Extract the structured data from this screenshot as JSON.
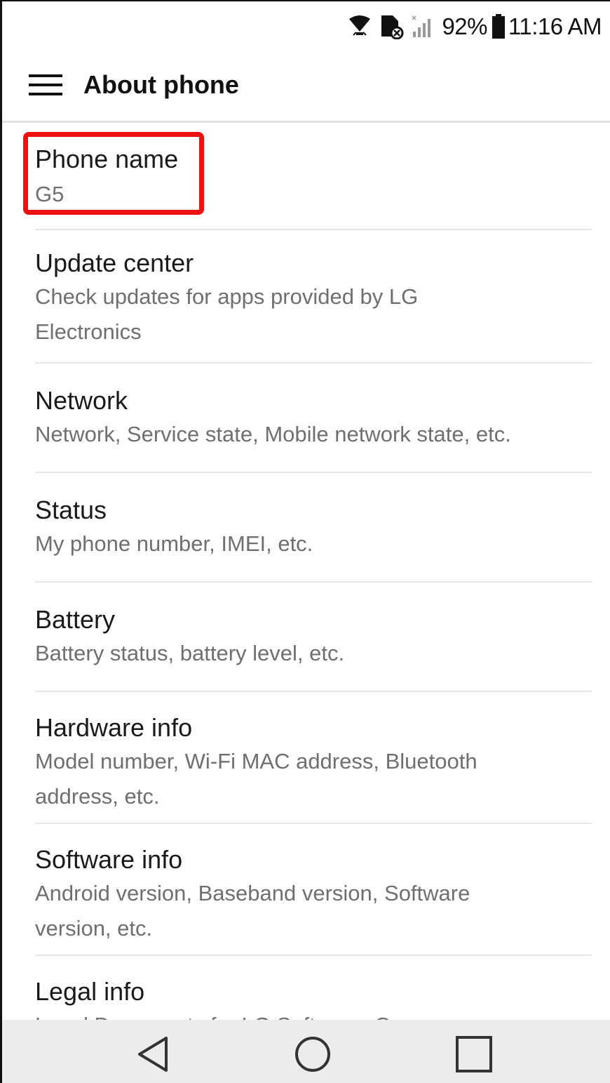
{
  "status_bar": {
    "battery_text": "92%",
    "time": "11:16 AM",
    "icons": [
      "wifi-icon",
      "sim-no-service-icon",
      "signal-icon",
      "battery-icon"
    ]
  },
  "toolbar": {
    "title": "About phone",
    "menu_icon": "hamburger-menu-icon"
  },
  "settings": {
    "items": [
      {
        "title": "Phone name",
        "summary": "G5"
      },
      {
        "title": "Update center",
        "summary": "Check updates for apps provided by LG Electronics"
      },
      {
        "title": "Network",
        "summary": "Network, Service state, Mobile network state, etc."
      },
      {
        "title": "Status",
        "summary": "My phone number, IMEI, etc."
      },
      {
        "title": "Battery",
        "summary": "Battery status, battery level, etc."
      },
      {
        "title": "Hardware info",
        "summary": "Model number, Wi-Fi MAC address, Bluetooth address, etc."
      },
      {
        "title": "Software info",
        "summary": "Android version, Baseband version, Software version, etc."
      },
      {
        "title": "Legal info",
        "summary": "Legal Documents for LG Software, Open source"
      }
    ]
  },
  "nav_bar": {
    "icons": [
      "back-icon",
      "home-icon",
      "recents-icon"
    ]
  },
  "colors": {
    "highlight": "#ee1111",
    "nav_background": "#ececec",
    "summary_text": "#6f6f6f"
  }
}
